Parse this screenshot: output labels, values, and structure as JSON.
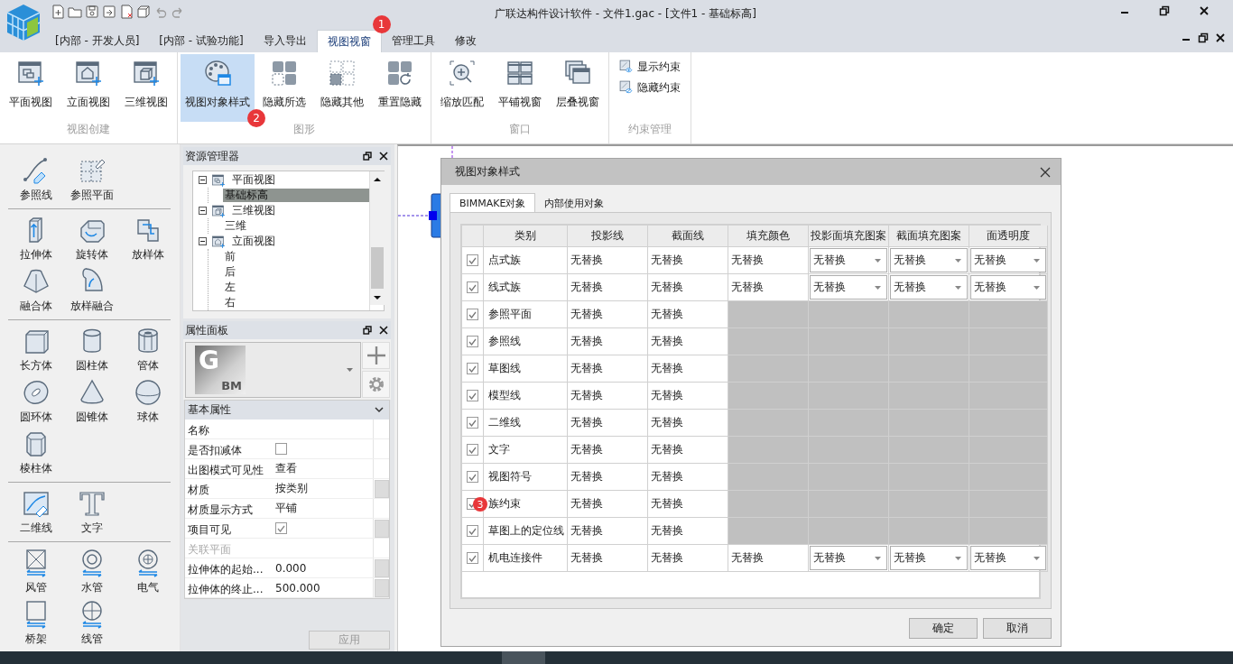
{
  "app": {
    "title": "广联达构件设计软件 - 文件1.gac - [文件1 - 基础标高]"
  },
  "tabs": [
    {
      "label": "[内部 - 开发人员]",
      "selected": false
    },
    {
      "label": "[内部 - 试验功能]",
      "selected": false
    },
    {
      "label": "导入导出",
      "selected": false
    },
    {
      "label": "视图视窗",
      "selected": true,
      "badge": "1"
    },
    {
      "label": "管理工具",
      "selected": false
    },
    {
      "label": "修改",
      "selected": false
    }
  ],
  "ribbon_groups": [
    {
      "label": "视图创建",
      "buttons": [
        {
          "label": "平面视图",
          "kind": "large",
          "selected": false
        },
        {
          "label": "立面视图",
          "kind": "large",
          "selected": false
        },
        {
          "label": "三维视图",
          "kind": "large",
          "selected": false
        }
      ]
    },
    {
      "label": "图形",
      "buttons": [
        {
          "label": "视图对象样式",
          "kind": "large",
          "selected": true,
          "badge": "2"
        },
        {
          "label": "隐藏所选",
          "kind": "large",
          "selected": false
        },
        {
          "label": "隐藏其他",
          "kind": "large",
          "selected": false
        },
        {
          "label": "重置隐藏",
          "kind": "large",
          "selected": false
        }
      ]
    },
    {
      "label": "窗口",
      "buttons": [
        {
          "label": "缩放匹配",
          "kind": "large",
          "selected": false
        },
        {
          "label": "平铺视窗",
          "kind": "large",
          "selected": false
        },
        {
          "label": "层叠视窗",
          "kind": "large",
          "selected": false
        }
      ]
    },
    {
      "label": "约束管理",
      "buttons": [
        {
          "label": "显示约束",
          "kind": "small",
          "selected": false
        },
        {
          "label": "隐藏约束",
          "kind": "small",
          "selected": false
        }
      ]
    }
  ],
  "palette": [
    {
      "tools": [
        {
          "label": "参照线"
        },
        {
          "label": "参照平面"
        }
      ]
    },
    {
      "tools": [
        {
          "label": "拉伸体"
        },
        {
          "label": "旋转体"
        },
        {
          "label": "放样体"
        },
        {
          "label": "融合体"
        },
        {
          "label": "放样融合"
        }
      ]
    },
    {
      "tools": [
        {
          "label": "长方体"
        },
        {
          "label": "圆柱体"
        },
        {
          "label": "管体"
        },
        {
          "label": "圆环体"
        },
        {
          "label": "圆锥体"
        },
        {
          "label": "球体"
        },
        {
          "label": "棱柱体"
        }
      ]
    },
    {
      "tools": [
        {
          "label": "二维线"
        },
        {
          "label": "文字"
        }
      ]
    },
    {
      "tools": [
        {
          "label": "风管"
        },
        {
          "label": "水管"
        },
        {
          "label": "电气"
        },
        {
          "label": "桥架"
        },
        {
          "label": "线管"
        }
      ]
    }
  ],
  "explorer": {
    "title": "资源管理器",
    "tree": [
      {
        "label": "平面视图",
        "expanded": true,
        "selected": false,
        "children": [
          {
            "label": "基础标高",
            "selected": true
          }
        ]
      },
      {
        "label": "三维视图",
        "expanded": true,
        "selected": false,
        "children": [
          {
            "label": "三维",
            "selected": false
          }
        ]
      },
      {
        "label": "立面视图",
        "expanded": true,
        "selected": false,
        "children": [
          {
            "label": "前",
            "selected": false
          },
          {
            "label": "后",
            "selected": false
          },
          {
            "label": "左",
            "selected": false
          },
          {
            "label": "右",
            "selected": false
          }
        ]
      }
    ]
  },
  "properties": {
    "title": "属性面板",
    "type_logo": {
      "letter": "G",
      "sub": "BM"
    },
    "section": "基本属性",
    "rows": [
      {
        "name": "名称",
        "kind": "text",
        "disabled": false,
        "button": false
      },
      {
        "name": "是否扣减体",
        "kind": "checkbox",
        "checked": false,
        "disabled": false,
        "button": false
      },
      {
        "name": "出图模式可见性",
        "kind": "text",
        "value": "查看",
        "disabled": false,
        "button": false
      },
      {
        "name": "材质",
        "kind": "text",
        "value": "按类别",
        "disabled": false,
        "button": true
      },
      {
        "name": "材质显示方式",
        "kind": "text",
        "value": "平铺",
        "disabled": false,
        "button": false
      },
      {
        "name": "项目可见",
        "kind": "checkbox",
        "checked": true,
        "disabled": false,
        "button": true
      },
      {
        "name": "关联平面",
        "kind": "text",
        "disabled": true,
        "button": false
      },
      {
        "name": "拉伸体的起始...",
        "kind": "text",
        "value": "0.000",
        "disabled": false,
        "button": true
      },
      {
        "name": "拉伸体的终止...",
        "kind": "text",
        "value": "500.000",
        "disabled": false,
        "button": true
      }
    ],
    "apply": {
      "label": "应用",
      "disabled": true
    }
  },
  "dialog": {
    "title": "视图对象样式",
    "tabs": [
      {
        "label": "BIMMAKE对象",
        "selected": true
      },
      {
        "label": "内部使用对象",
        "selected": false
      }
    ],
    "columns": [
      "类别",
      "投影线",
      "截面线",
      "填充颜色",
      "投影面填充图案",
      "截面填充图案",
      "面透明度"
    ],
    "rows": [
      {
        "checked": true,
        "cells": [
          {
            "kind": "text",
            "text": "点式族"
          },
          {
            "kind": "text",
            "text": "无替换"
          },
          {
            "kind": "text",
            "text": "无替换"
          },
          {
            "kind": "text",
            "text": "无替换"
          },
          {
            "kind": "dropdown",
            "text": "无替换"
          },
          {
            "kind": "dropdown",
            "text": "无替换"
          },
          {
            "kind": "dropdown",
            "text": "无替换"
          }
        ]
      },
      {
        "checked": true,
        "cells": [
          {
            "kind": "text",
            "text": "线式族"
          },
          {
            "kind": "text",
            "text": "无替换"
          },
          {
            "kind": "text",
            "text": "无替换"
          },
          {
            "kind": "text",
            "text": "无替换"
          },
          {
            "kind": "dropdown",
            "text": "无替换"
          },
          {
            "kind": "dropdown",
            "text": "无替换"
          },
          {
            "kind": "dropdown",
            "text": "无替换"
          }
        ]
      },
      {
        "checked": true,
        "cells": [
          {
            "kind": "text",
            "text": "参照平面"
          },
          {
            "kind": "text",
            "text": "无替换"
          },
          {
            "kind": "text",
            "text": "无替换"
          },
          {
            "kind": "blank"
          },
          {
            "kind": "blank"
          },
          {
            "kind": "blank"
          },
          {
            "kind": "blank"
          }
        ]
      },
      {
        "checked": true,
        "cells": [
          {
            "kind": "text",
            "text": "参照线"
          },
          {
            "kind": "text",
            "text": "无替换"
          },
          {
            "kind": "text",
            "text": "无替换"
          },
          {
            "kind": "blank"
          },
          {
            "kind": "blank"
          },
          {
            "kind": "blank"
          },
          {
            "kind": "blank"
          }
        ]
      },
      {
        "checked": true,
        "cells": [
          {
            "kind": "text",
            "text": "草图线"
          },
          {
            "kind": "text",
            "text": "无替换"
          },
          {
            "kind": "text",
            "text": "无替换"
          },
          {
            "kind": "blank"
          },
          {
            "kind": "blank"
          },
          {
            "kind": "blank"
          },
          {
            "kind": "blank"
          }
        ]
      },
      {
        "checked": true,
        "cells": [
          {
            "kind": "text",
            "text": "模型线"
          },
          {
            "kind": "text",
            "text": "无替换"
          },
          {
            "kind": "text",
            "text": "无替换"
          },
          {
            "kind": "blank"
          },
          {
            "kind": "blank"
          },
          {
            "kind": "blank"
          },
          {
            "kind": "blank"
          }
        ]
      },
      {
        "checked": true,
        "cells": [
          {
            "kind": "text",
            "text": "二维线"
          },
          {
            "kind": "text",
            "text": "无替换"
          },
          {
            "kind": "text",
            "text": "无替换"
          },
          {
            "kind": "blank"
          },
          {
            "kind": "blank"
          },
          {
            "kind": "blank"
          },
          {
            "kind": "blank"
          }
        ]
      },
      {
        "checked": true,
        "cells": [
          {
            "kind": "text",
            "text": "文字"
          },
          {
            "kind": "text",
            "text": "无替换"
          },
          {
            "kind": "text",
            "text": "无替换"
          },
          {
            "kind": "blank"
          },
          {
            "kind": "blank"
          },
          {
            "kind": "blank"
          },
          {
            "kind": "blank"
          }
        ]
      },
      {
        "checked": true,
        "cells": [
          {
            "kind": "text",
            "text": "视图符号"
          },
          {
            "kind": "text",
            "text": "无替换"
          },
          {
            "kind": "text",
            "text": "无替换"
          },
          {
            "kind": "blank"
          },
          {
            "kind": "blank"
          },
          {
            "kind": "blank"
          },
          {
            "kind": "blank"
          }
        ]
      },
      {
        "checked": true,
        "badge": "3",
        "cells": [
          {
            "kind": "text",
            "text": "族约束"
          },
          {
            "kind": "text",
            "text": "无替换"
          },
          {
            "kind": "text",
            "text": "无替换"
          },
          {
            "kind": "blank"
          },
          {
            "kind": "blank"
          },
          {
            "kind": "blank"
          },
          {
            "kind": "blank"
          }
        ]
      },
      {
        "checked": true,
        "cells": [
          {
            "kind": "text",
            "text": "草图上的定位线"
          },
          {
            "kind": "text",
            "text": "无替换"
          },
          {
            "kind": "text",
            "text": "无替换"
          },
          {
            "kind": "blank"
          },
          {
            "kind": "blank"
          },
          {
            "kind": "blank"
          },
          {
            "kind": "blank"
          }
        ]
      },
      {
        "checked": true,
        "cells": [
          {
            "kind": "text",
            "text": "机电连接件"
          },
          {
            "kind": "text",
            "text": "无替换"
          },
          {
            "kind": "text",
            "text": "无替换"
          },
          {
            "kind": "text",
            "text": "无替换"
          },
          {
            "kind": "dropdown",
            "text": "无替换"
          },
          {
            "kind": "dropdown",
            "text": "无替换"
          },
          {
            "kind": "dropdown",
            "text": "无替换"
          }
        ]
      }
    ],
    "buttons": [
      "确定",
      "取消"
    ]
  }
}
